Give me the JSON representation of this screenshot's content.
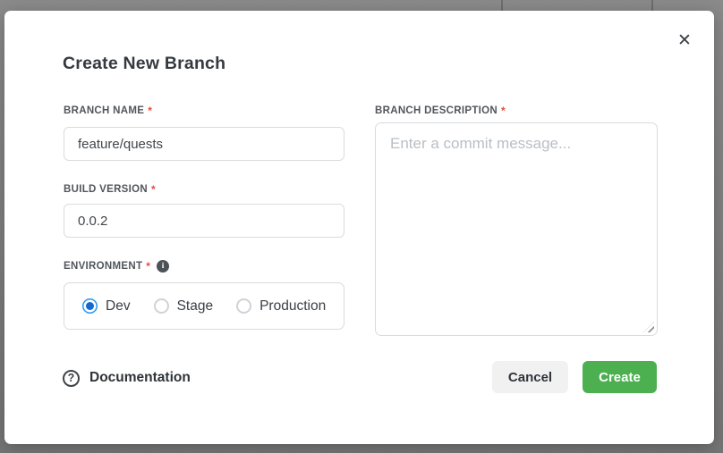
{
  "modal": {
    "title": "Create New Branch",
    "fields": {
      "branch_name": {
        "label": "BRANCH NAME",
        "required_marker": "*",
        "value": "feature/quests"
      },
      "build_version": {
        "label": "BUILD VERSION",
        "required_marker": "*",
        "value": "0.0.2"
      },
      "environment": {
        "label": "ENVIRONMENT",
        "required_marker": "*",
        "info_icon": "info-circle",
        "options": [
          {
            "label": "Dev",
            "selected": true
          },
          {
            "label": "Stage",
            "selected": false
          },
          {
            "label": "Production",
            "selected": false
          }
        ]
      },
      "branch_description": {
        "label": "BRANCH DESCRIPTION",
        "required_marker": "*",
        "value": "",
        "placeholder": "Enter a commit message..."
      }
    },
    "footer": {
      "documentation_label": "Documentation",
      "cancel_label": "Cancel",
      "create_label": "Create"
    },
    "icons": {
      "close": "✕",
      "help": "?",
      "info": "i"
    }
  },
  "colors": {
    "accent_green": "#4caf50",
    "radio_selected_blue": "#2196f3",
    "required_red": "#e74c3c",
    "overlay_gray": "#808080"
  }
}
